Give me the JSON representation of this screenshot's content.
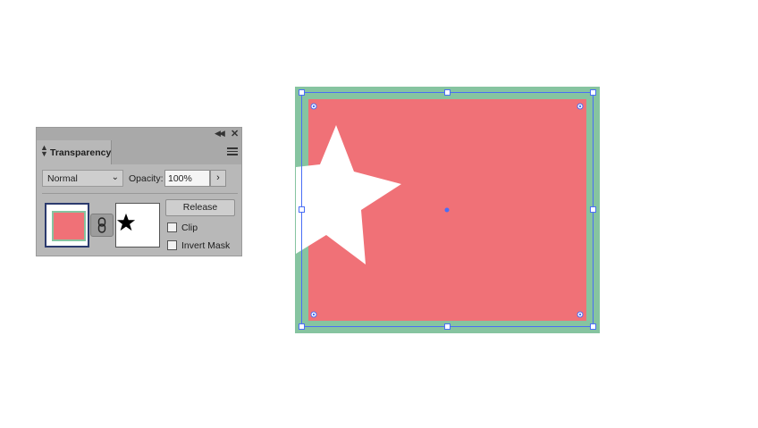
{
  "panel": {
    "title": "Transparency",
    "blend_mode": "Normal",
    "opacity_label": "Opacity:",
    "opacity_value": "100%",
    "release_label": "Release",
    "clip_label": "Clip",
    "clip_checked": false,
    "invert_mask_label": "Invert Mask",
    "invert_mask_checked": false
  },
  "icons": {
    "collapse": "double-chevron-left-icon",
    "close": "close-icon",
    "panel_menu": "hamburger-menu-icon",
    "link": "chain-link-icon",
    "mask_star": "star-icon"
  },
  "colors": {
    "rectangle_fill": "#f07177",
    "rectangle_border": "#86c4a0",
    "selection": "#4a6ef5",
    "panel_bg": "#b8b8b8"
  }
}
